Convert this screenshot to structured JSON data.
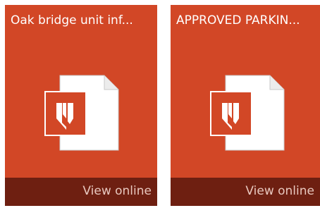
{
  "colors": {
    "tile_bg": "#d24726",
    "footer_bg": "#6e1f11",
    "title_text": "#ffffff",
    "footer_text": "#e8c8bf"
  },
  "tiles": [
    {
      "title": "Oak bridge unit inf...",
      "icon": "pdf-file-icon",
      "action_label": "View online"
    },
    {
      "title": "APPROVED PARKIN...",
      "icon": "pdf-file-icon",
      "action_label": "View online"
    }
  ]
}
